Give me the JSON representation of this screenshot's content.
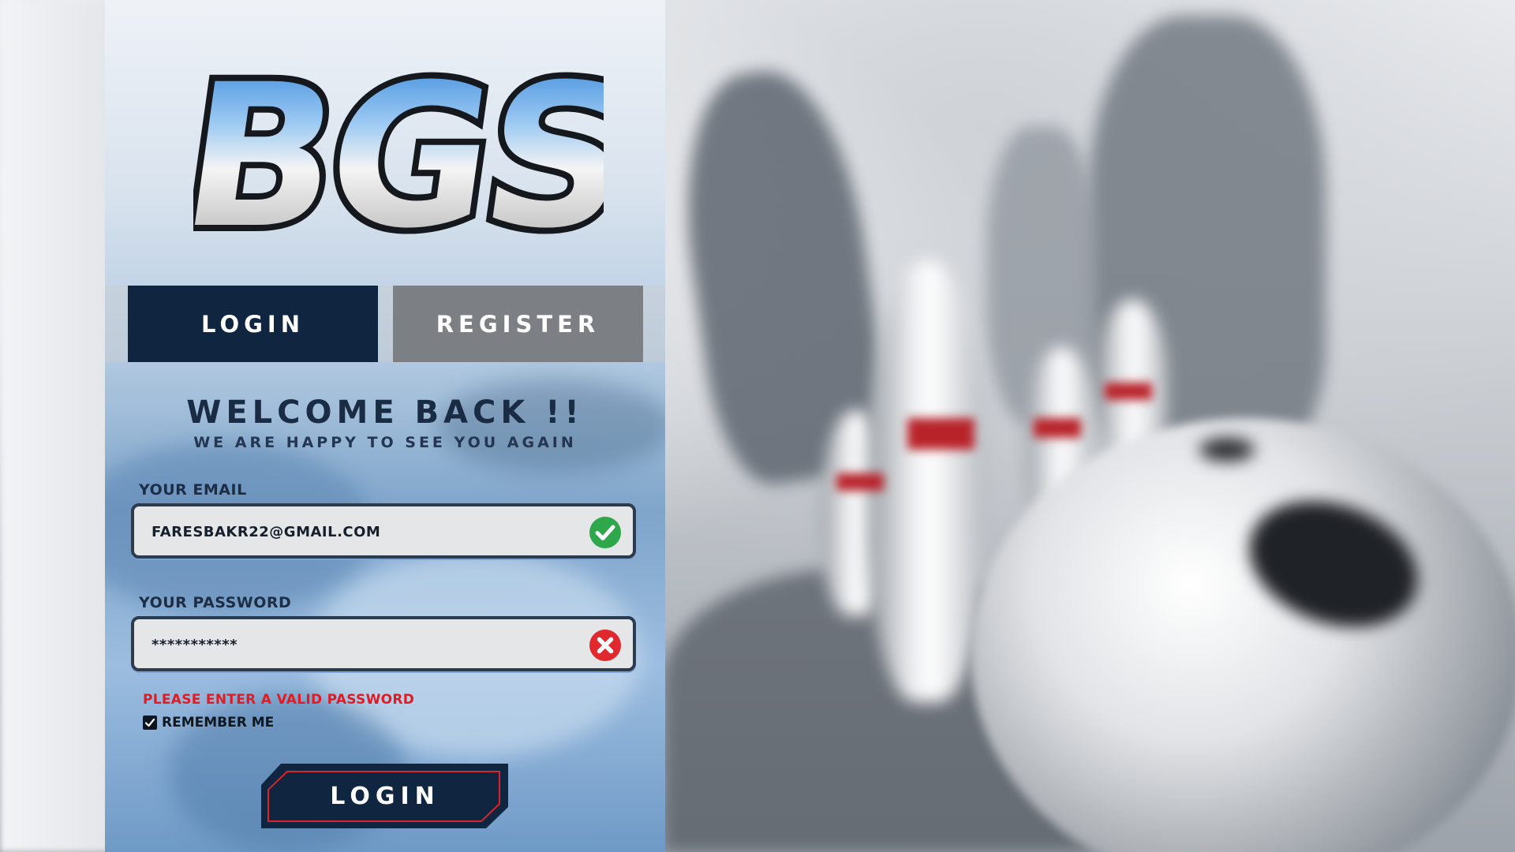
{
  "app": {
    "logo_text": "BGS"
  },
  "tabs": {
    "login_label": "LOGIN",
    "register_label": "REGISTER",
    "active": "login"
  },
  "form": {
    "heading": "WELCOME BACK !!",
    "subheading": "WE ARE HAPPY TO SEE YOU AGAIN",
    "email": {
      "label": "YOUR EMAIL",
      "value": "FARESBAKR22@GMAIL.COM",
      "status": "valid",
      "status_icon": "check-circle-icon"
    },
    "password": {
      "label": "YOUR PASSWORD",
      "value": "***********",
      "status": "invalid",
      "status_icon": "error-circle-icon",
      "error_message": "PLEASE ENTER A VALID PASSWORD"
    },
    "remember_me": {
      "label": "REMEMBER ME",
      "checked": true
    },
    "submit_label": "LOGIN"
  },
  "colors": {
    "navy": "#0f2540",
    "tab_inactive": "#7c7f83",
    "valid": "#2ea84a",
    "error": "#e01b24"
  }
}
